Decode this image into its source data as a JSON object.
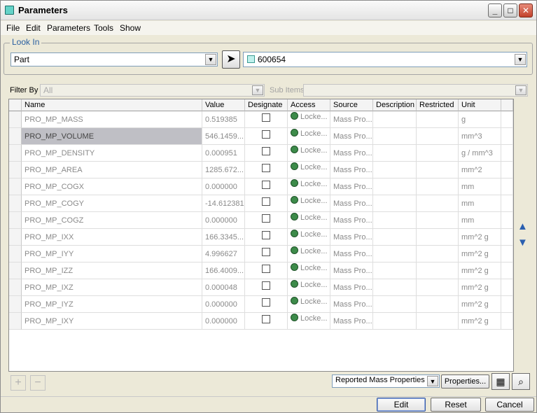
{
  "window": {
    "title": "Parameters"
  },
  "menu": [
    "File",
    "Edit",
    "Parameters",
    "Tools",
    "Show"
  ],
  "look_in": {
    "legend": "Look In",
    "type_value": "Part",
    "object_value": "600654"
  },
  "filter": {
    "filter_by_label": "Filter By",
    "filter_by_value": "All",
    "sub_items_label": "Sub Items"
  },
  "table": {
    "columns": [
      "Name",
      "Value",
      "Designate",
      "Access",
      "Source",
      "Description",
      "Restricted",
      "Unit"
    ],
    "rows": [
      {
        "name": "PRO_MP_MASS",
        "value": "0.519385",
        "access": "Locke...",
        "source": "Mass Pro...",
        "unit": "g"
      },
      {
        "name": "PRO_MP_VOLUME",
        "value": "546.1459...",
        "access": "Locke...",
        "source": "Mass Pro...",
        "unit": "mm^3"
      },
      {
        "name": "PRO_MP_DENSITY",
        "value": "0.000951",
        "access": "Locke...",
        "source": "Mass Pro...",
        "unit": "g / mm^3"
      },
      {
        "name": "PRO_MP_AREA",
        "value": "1285.672...",
        "access": "Locke...",
        "source": "Mass Pro...",
        "unit": "mm^2"
      },
      {
        "name": "PRO_MP_COGX",
        "value": "0.000000",
        "access": "Locke...",
        "source": "Mass Pro...",
        "unit": "mm"
      },
      {
        "name": "PRO_MP_COGY",
        "value": "-14.612381",
        "access": "Locke...",
        "source": "Mass Pro...",
        "unit": "mm"
      },
      {
        "name": "PRO_MP_COGZ",
        "value": "0.000000",
        "access": "Locke...",
        "source": "Mass Pro...",
        "unit": "mm"
      },
      {
        "name": "PRO_MP_IXX",
        "value": "166.3345...",
        "access": "Locke...",
        "source": "Mass Pro...",
        "unit": "mm^2 g"
      },
      {
        "name": "PRO_MP_IYY",
        "value": "4.996627",
        "access": "Locke...",
        "source": "Mass Pro...",
        "unit": "mm^2 g"
      },
      {
        "name": "PRO_MP_IZZ",
        "value": "166.4009...",
        "access": "Locke...",
        "source": "Mass Pro...",
        "unit": "mm^2 g"
      },
      {
        "name": "PRO_MP_IXZ",
        "value": "0.000048",
        "access": "Locke...",
        "source": "Mass Pro...",
        "unit": "mm^2 g"
      },
      {
        "name": "PRO_MP_IYZ",
        "value": "0.000000",
        "access": "Locke...",
        "source": "Mass Pro...",
        "unit": "mm^2 g"
      },
      {
        "name": "PRO_MP_IXY",
        "value": "0.000000",
        "access": "Locke...",
        "source": "Mass Pro...",
        "unit": "mm^2 g"
      }
    ],
    "selected_row": "PRO_MP_VOLUME"
  },
  "bottom": {
    "add_label": "+",
    "remove_label": "−",
    "properties_select": "Reported Mass Properties",
    "properties_button": "Properties...",
    "edit_button": "Edit",
    "reset_button": "Reset",
    "cancel_button": "Cancel"
  },
  "icons": [
    "window-icon",
    "minimize-icon",
    "maximize-icon",
    "close-icon",
    "pointer-icon",
    "part-icon",
    "lock-icon",
    "scroll-up-icon",
    "scroll-down-icon",
    "table-view-icon",
    "binoculars-icon"
  ]
}
